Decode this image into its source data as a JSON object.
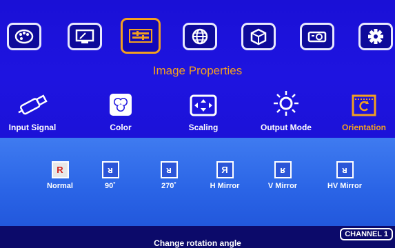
{
  "tabs": [
    {
      "icon": "palette-icon",
      "active": false
    },
    {
      "icon": "monitor-icon",
      "active": false
    },
    {
      "icon": "image-properties-icon",
      "active": true
    },
    {
      "icon": "globe-icon",
      "active": false
    },
    {
      "icon": "3d-cube-icon",
      "active": false
    },
    {
      "icon": "projector-icon",
      "active": false
    },
    {
      "icon": "gear-icon",
      "active": false
    }
  ],
  "section_title": "Image Properties",
  "categories": [
    {
      "label": "Input Signal",
      "icon": "usb-plug-icon",
      "active": false
    },
    {
      "label": "Color",
      "icon": "color-circles-icon",
      "active": false
    },
    {
      "label": "Scaling",
      "icon": "scaling-arrows-icon",
      "active": false
    },
    {
      "label": "Output Mode",
      "icon": "sun-icon",
      "active": false
    },
    {
      "label": "Orientation",
      "icon": "rotate-icon",
      "active": true
    }
  ],
  "orientation_options": [
    {
      "glyph": "R",
      "label": "Normal",
      "active": true
    },
    {
      "glyph": "ᴚ",
      "label": "90˚",
      "active": false
    },
    {
      "glyph": "ᴚ",
      "label": "270˚",
      "active": false
    },
    {
      "glyph": "Я",
      "label": "H Mirror",
      "active": false
    },
    {
      "glyph": "ʁ",
      "label": "V Mirror",
      "active": false
    },
    {
      "glyph": "ᴚ",
      "label": "HV Mirror",
      "active": false
    }
  ],
  "status": {
    "message": "Change rotation angle",
    "channel": "CHANNEL 1"
  },
  "colors": {
    "accent": "#f2a020",
    "top_bg": "#1e14e0",
    "bottom_bg": "#2a64e6",
    "status_bg": "#0c0a6a"
  }
}
